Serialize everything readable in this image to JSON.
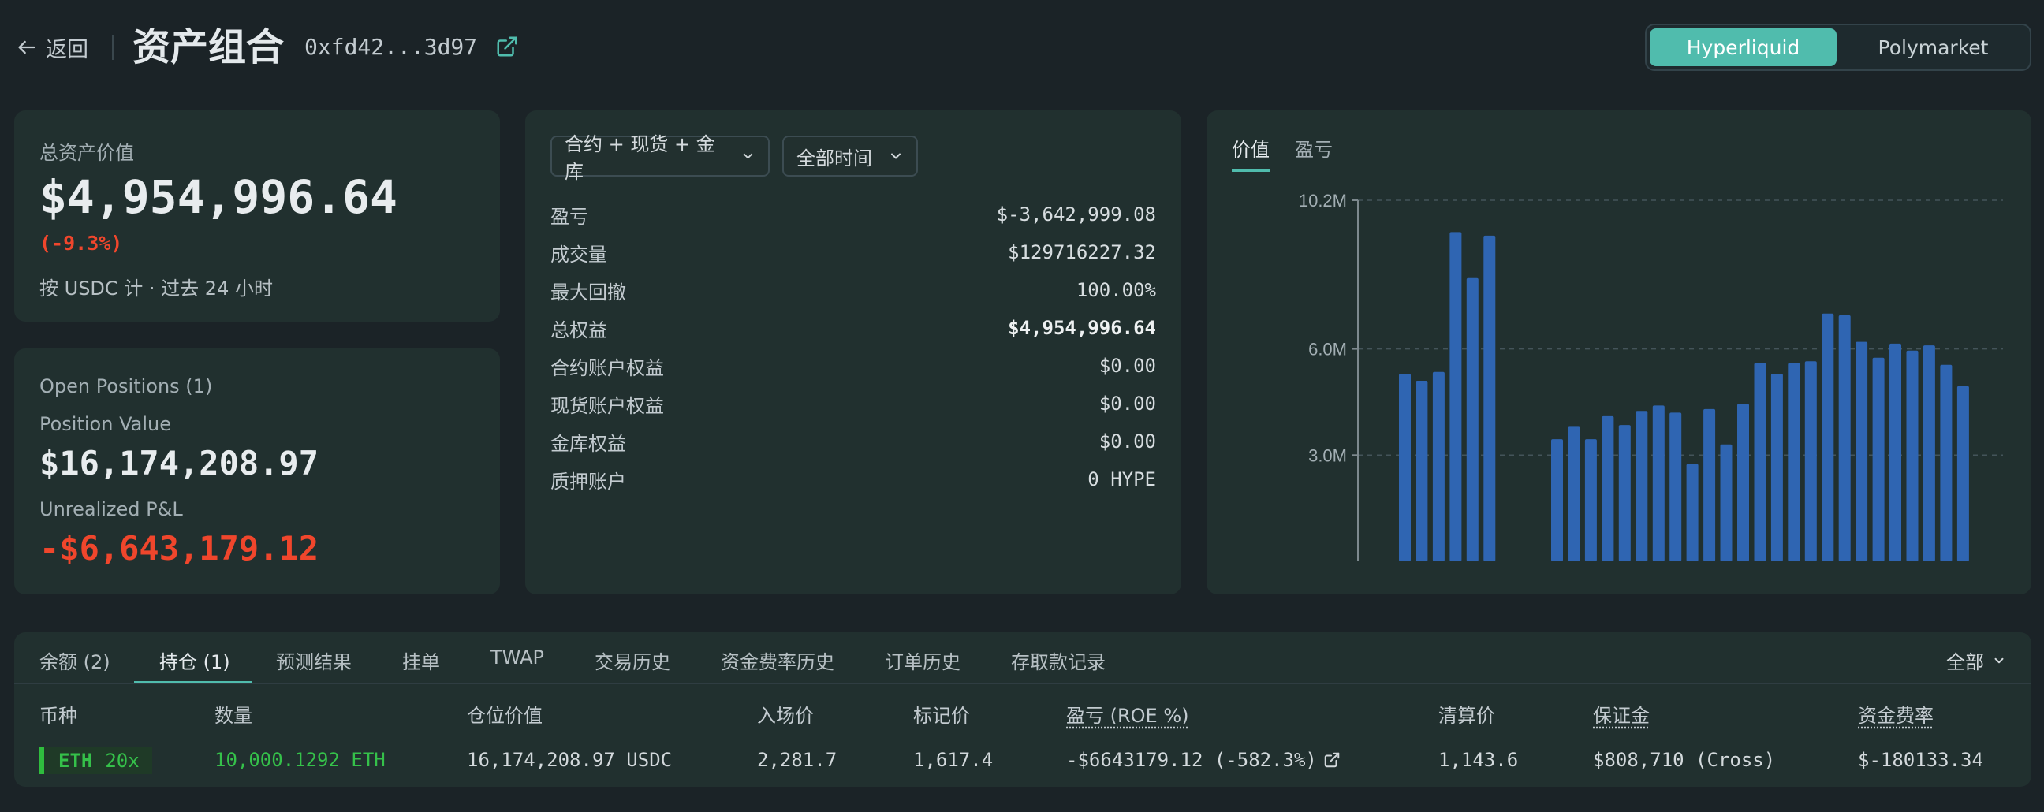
{
  "header": {
    "back_label": "返回",
    "title": "资产组合",
    "address": "0xfd42...3d97",
    "switch": [
      "Hyperliquid",
      "Polymarket"
    ],
    "switch_active": "Hyperliquid"
  },
  "summary": {
    "label": "总资产价值",
    "value": "$4,954,996.64",
    "change": "(-9.3%)",
    "sub": "按 USDC 计 · 过去 24 小时"
  },
  "positions": {
    "title": "Open Positions (1)",
    "value_label": "Position Value",
    "value": "$16,174,208.97",
    "pnl_label": "Unrealized P&L",
    "pnl": "-$6,643,179.12"
  },
  "stats": {
    "filter_scope": "合约 + 现货 + 金库",
    "filter_time": "全部时间",
    "rows": [
      {
        "label": "盈亏",
        "value": "$-3,642,999.08"
      },
      {
        "label": "成交量",
        "value": "$129716227.32"
      },
      {
        "label": "最大回撤",
        "value": "100.00%"
      },
      {
        "label": "总权益",
        "value": "$4,954,996.64"
      },
      {
        "label": "合约账户权益",
        "value": "$0.00"
      },
      {
        "label": "现货账户权益",
        "value": "$0.00"
      },
      {
        "label": "金库权益",
        "value": "$0.00"
      },
      {
        "label": "质押账户",
        "value": "0 HYPE"
      }
    ]
  },
  "chart_tabs": [
    "价值",
    "盈亏"
  ],
  "chart_data": {
    "type": "bar",
    "ytick_labels": [
      "10.2M",
      "6.0M",
      "3.0M"
    ],
    "yticks": [
      10.2,
      6.0,
      3.0
    ],
    "ylim": [
      0,
      10.2
    ],
    "unit": "M",
    "grid": true,
    "values": [
      5.3,
      5.1,
      5.35,
      9.3,
      8.0,
      9.2,
      null,
      null,
      null,
      3.45,
      3.8,
      3.45,
      4.1,
      3.85,
      4.25,
      4.4,
      4.2,
      2.75,
      4.3,
      3.3,
      4.45,
      5.6,
      5.3,
      5.6,
      5.65,
      7.0,
      6.95,
      6.2,
      5.75,
      6.15,
      5.95,
      6.1,
      5.55,
      4.95
    ],
    "color": "#2f65b2"
  },
  "table": {
    "tabs": [
      "余额 (2)",
      "持仓 (1)",
      "预测结果",
      "挂单",
      "TWAP",
      "交易历史",
      "资金费率历史",
      "订单历史",
      "存取款记录"
    ],
    "active_tab": "持仓 (1)",
    "filter": "全部",
    "columns": [
      "币种",
      "数量",
      "仓位价值",
      "入场价",
      "标记价",
      "盈亏 (ROE %)",
      "清算价",
      "保证金",
      "资金费率"
    ],
    "row": {
      "coin": "ETH",
      "leverage": "20x",
      "size": "10,000.1292 ETH",
      "position_value": "16,174,208.97 USDC",
      "entry": "2,281.7",
      "mark": "1,617.4",
      "pnl": "-$6643179.12 (-582.3%)",
      "liq": "1,143.6",
      "margin": "$808,710 (Cross)",
      "funding": "$-180133.34"
    }
  },
  "colors": {
    "accent": "#50bcad",
    "negative": "#f0462c",
    "positive": "#35c14a",
    "bar": "#2f65b2"
  }
}
